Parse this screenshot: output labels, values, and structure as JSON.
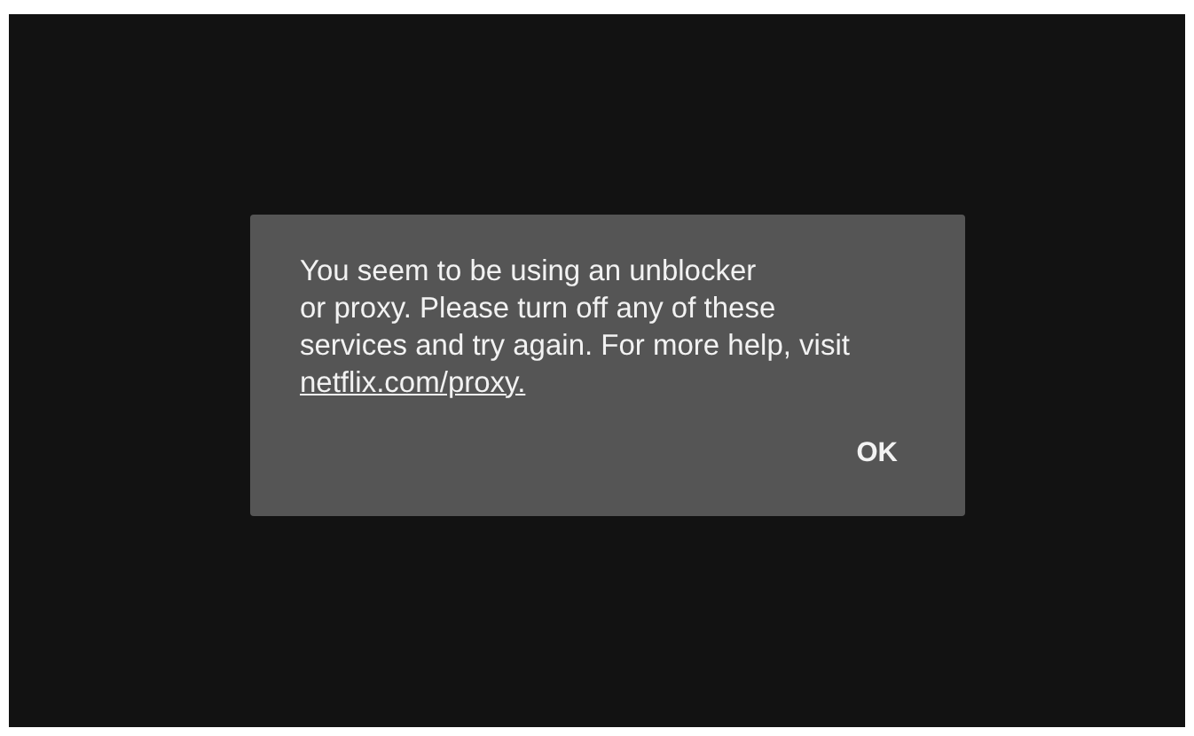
{
  "dialog": {
    "message": {
      "lines": [
        "You seem to be using an unblocker",
        "or proxy. Please turn off any of these",
        "services and try again. For more help, visit"
      ],
      "link": "netflix.com/proxy."
    },
    "buttons": [
      "OK"
    ]
  }
}
